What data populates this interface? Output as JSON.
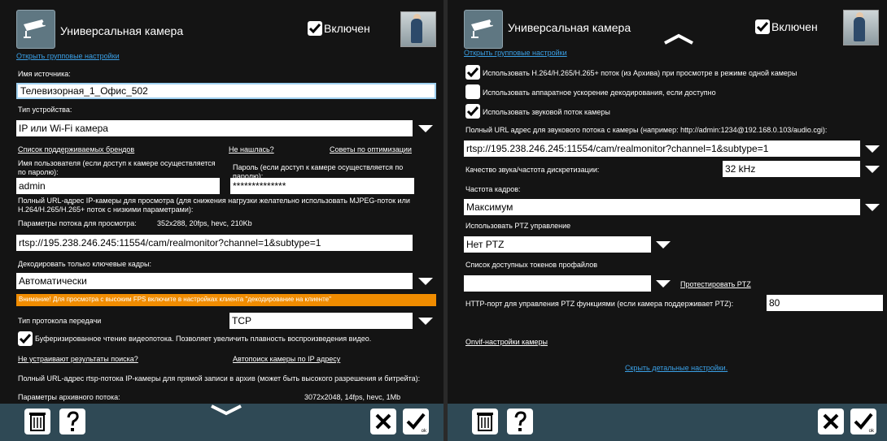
{
  "header": {
    "title": "Универсальная камера",
    "enabled_label": "Включен",
    "group_link": "Открыть групповые настройки"
  },
  "left": {
    "source_name_label": "Имя источника:",
    "source_name_value": "Телевизорная_1_Офис_502",
    "device_type_label": "Тип устройства:",
    "device_type_value": "IP или Wi-Fi камера",
    "brands_link": "Список поддерживаемых брендов",
    "not_found_link": "Не нашлась?",
    "optimization_link": "Советы по оптимизации",
    "username_label": "Имя пользователя (если доступ к камере осуществляется по паролю):",
    "username_value": "admin",
    "password_label": "Пароль (если доступ к камере осуществляется по паролю):",
    "password_value": "**************",
    "url_view_label": "Полный URL-адрес IP-камеры для просмотра (для снижения нагрузки желательно использовать MJPEG-поток или H.264/H.265/H.265+ поток с низкими параметрами):",
    "stream_params_label": "Параметры потока для просмотра:",
    "stream_params_value": "352x288, 20fps, hevc, 210Kb",
    "url_view_value": "rtsp://195.238.246.245:11554/cam/realmonitor?channel=1&subtype=1",
    "decode_keyframes_label": "Декодировать только ключевые кадры:",
    "decode_keyframes_value": "Автоматически",
    "warning": "Внимание! Для просмотра с высоким FPS включите в настройках клиента \"декодирование на клиенте\"",
    "protocol_label": "Тип протокола передачи",
    "protocol_value": "TCP",
    "buffered_label": "Буферизированное чтение видеопотока. Позволяет увеличить плавность воспроизведения видео.",
    "bad_results_link": "Не устраивают результаты поиска?",
    "autosearch_link": "Автопоиск камеры по IP адресу",
    "url_archive_label": "Полный URL-адрес rtsp-потока IP-камеры для прямой записи в архив (может быть высокого разрешения и битрейта):",
    "archive_params_label": "Параметры архивного потока:",
    "archive_params_value": "3072x2048, 14fps, hevc, 1Mb"
  },
  "right": {
    "use_h264_label": "Использовать H.264/H.265/H.265+ поток (из Архива) при просмотре в режиме одной камеры",
    "hw_accel_label": "Использовать аппаратное ускорение декодирования, если доступно",
    "audio_label": "Использовать звуковой поток камеры",
    "audio_url_label": "Полный URL адрес для звукового потока с камеры (например: http://admin:1234@192.168.0.103/audio.cgi):",
    "audio_url_value": "rtsp://195.238.246.245:11554/cam/realmonitor?channel=1&subtype=1",
    "audio_quality_label": "Качество звука/частота дискретизации:",
    "audio_quality_value": "32 kHz",
    "fps_label": "Частота кадров:",
    "fps_value": "Максимум",
    "ptz_label": "Использовать PTZ управление",
    "ptz_value": "Нет PTZ",
    "tokens_label": "Список доступных токенов профайлов",
    "tokens_value": "",
    "test_ptz_link": "Протестировать PTZ",
    "http_port_label": "HTTP-порт для управления PTZ функциями (если камера поддерживает PTZ):",
    "http_port_value": "80",
    "onvif_link": "Onvif-настройки камеры",
    "hide_details_link": "Скрыть детальные настройки."
  },
  "footer": {
    "help_label": "?",
    "ok_label": "ok"
  },
  "colors": {
    "footer": "#2f4955",
    "link": "#3aa0e6",
    "warning": "#f08c00"
  },
  "icons": [
    "camera-icon",
    "checkbox-icon",
    "trash-icon",
    "help-icon",
    "close-icon",
    "ok-icon",
    "chevron-up-icon",
    "chevron-down-icon",
    "dropdown-arrow-icon"
  ]
}
